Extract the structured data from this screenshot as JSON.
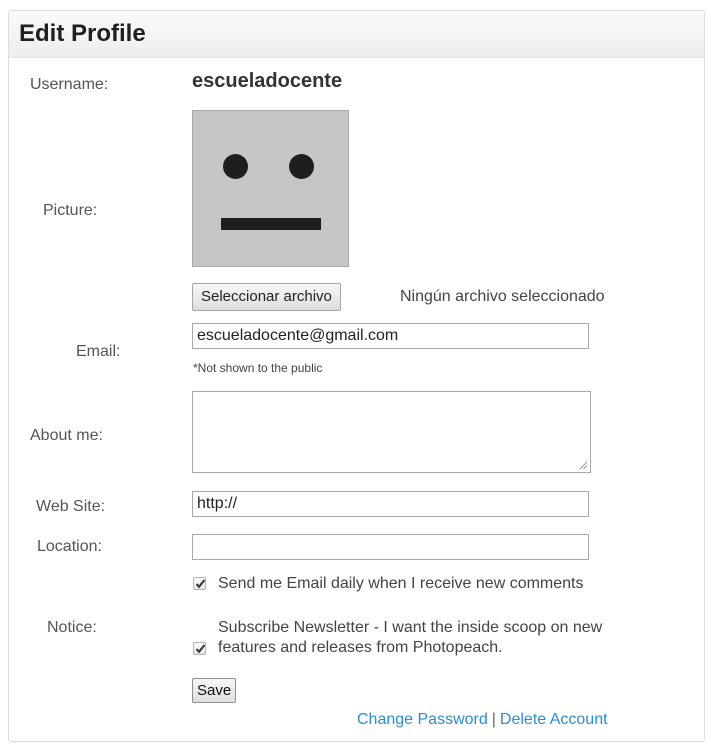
{
  "page_title": "Edit Profile",
  "labels": {
    "username": "Username:",
    "picture": "Picture:",
    "email": "Email:",
    "about": "About me:",
    "website": "Web Site:",
    "location": "Location:",
    "notice": "Notice:"
  },
  "username": "escueladocente",
  "picture": {
    "file_button": "Seleccionar archivo",
    "file_status": "Ningún archivo seleccionado"
  },
  "email": {
    "value": "escueladocente@gmail.com",
    "hint": "*Not shown to the public"
  },
  "about": {
    "value": ""
  },
  "website": {
    "value": "http://"
  },
  "location": {
    "value": ""
  },
  "notices": [
    {
      "label": "Send me Email daily when I receive new comments",
      "checked": true
    },
    {
      "label_line1": "Subscribe Newsletter - I want the inside scoop on new",
      "label_line2": "features and releases from Photopeach.",
      "checked": true
    }
  ],
  "save_label": "Save",
  "links": {
    "change_password": "Change Password",
    "separator": "|",
    "delete_account": "Delete Account"
  },
  "icons": [
    "avatar-placeholder-icon",
    "checkmark-icon",
    "resize-grip-icon"
  ],
  "colors": {
    "link": "#2a8ed1",
    "avatar_bg": "#c6c6c6",
    "avatar_features": "#1e1e1e"
  }
}
